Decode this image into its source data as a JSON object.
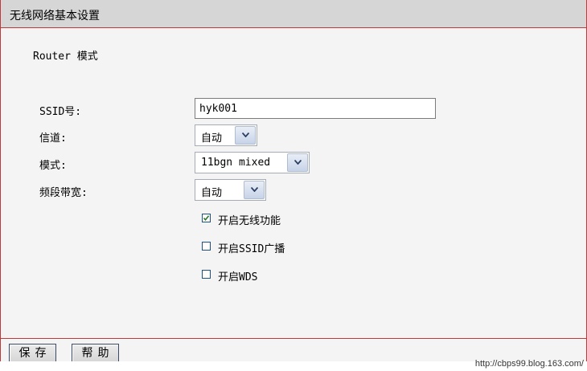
{
  "page_title": "无线网络基本设置",
  "mode_label": "Router 模式",
  "fields": {
    "ssid": {
      "label": "SSID号:",
      "value": "hyk001"
    },
    "channel": {
      "label": "信道:",
      "value": "自动"
    },
    "mode": {
      "label": "模式:",
      "value": "11bgn mixed"
    },
    "bandwidth": {
      "label": "频段带宽:",
      "value": "自动"
    }
  },
  "options": [
    {
      "label": "开启无线功能",
      "checked": true
    },
    {
      "label": "开启SSID广播",
      "checked": false
    },
    {
      "label": "开启WDS",
      "checked": false
    }
  ],
  "buttons": {
    "save": "保存",
    "help": "帮助"
  },
  "watermark": "http://cbps99.blog.163.com/",
  "colors": {
    "border": "#c0393b",
    "title_bg": "#d6d6d6",
    "panel_bg": "#f4f4f4"
  }
}
